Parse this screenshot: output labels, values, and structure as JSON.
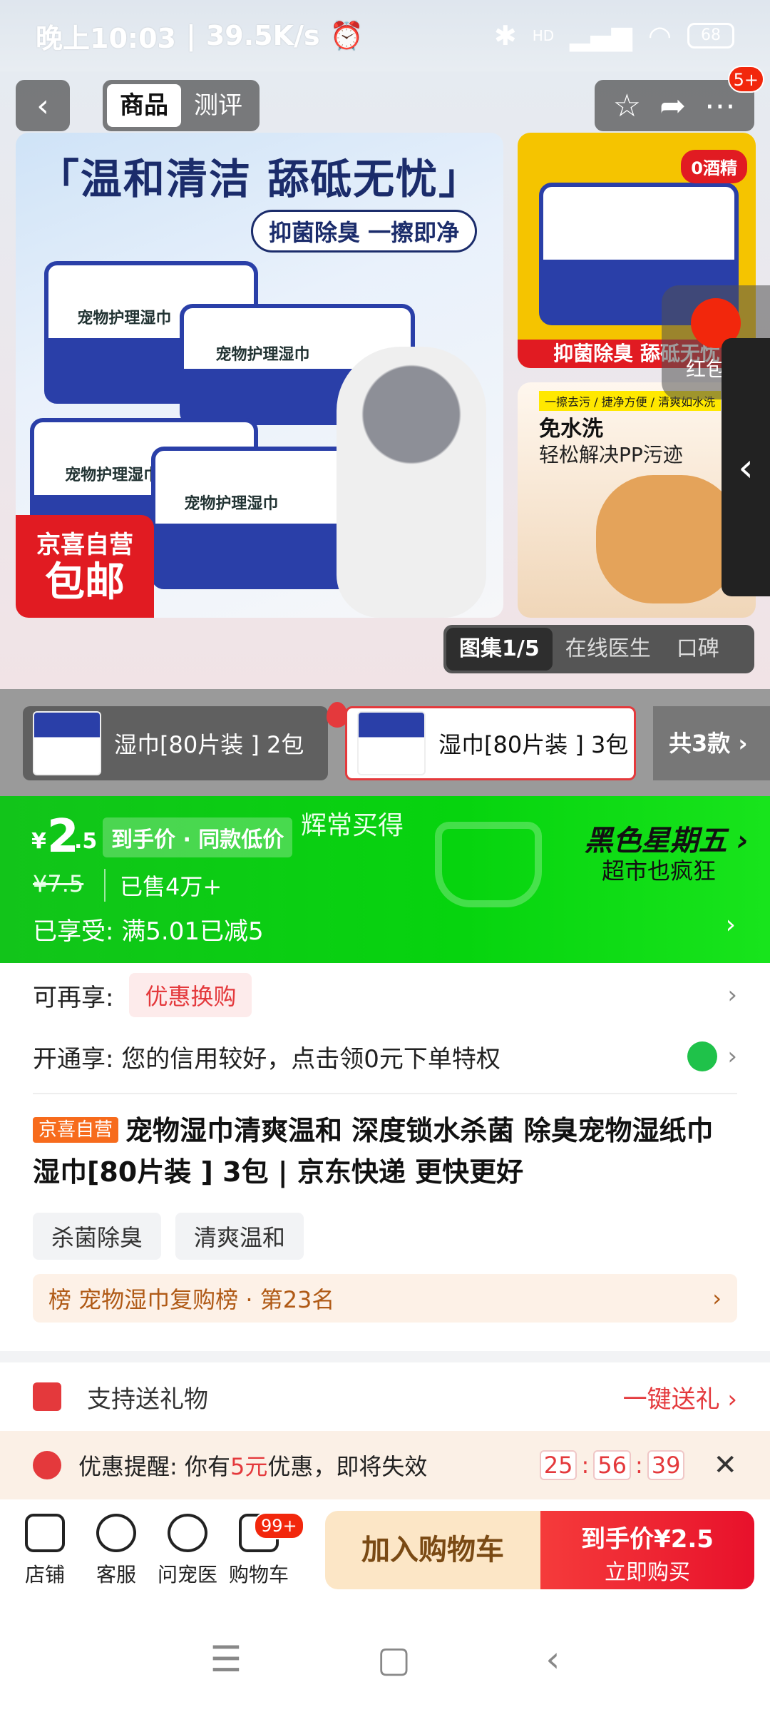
{
  "status": {
    "time": "晚上10:03",
    "speed": "39.5K/s",
    "battery": "68",
    "network": "HD"
  },
  "topnav": {
    "tabs": [
      "商品",
      "测评"
    ],
    "badge": "5+"
  },
  "main_image": {
    "headline": "「温和清洁 舔砥无忧」",
    "subline": "抑菌除臭 一擦即净",
    "pack_label": "宠物护理湿巾",
    "promo_line1": "京喜自营",
    "promo_line2": "包邮"
  },
  "thumb1": {
    "badge": "0酒精",
    "caption": "抑菌除臭 舔砥无忧"
  },
  "thumb2": {
    "tag": "一擦去污 / 捷净方便 / 清爽如水洗",
    "line1": "免水洗",
    "line2": "轻松解决PP污迹"
  },
  "redpack": {
    "label": "红包雨"
  },
  "gallery_tabs": [
    "图集1/5",
    "在线医生",
    "口碑"
  ],
  "sku": {
    "item1": "湿巾[80片装 ] 2包",
    "item2": "湿巾[80片装 ] 3包",
    "count": "共3款 ›"
  },
  "price": {
    "currency": "¥",
    "int": "2",
    "dec": ".5",
    "tag": "到手价 · 同款低价",
    "hui": "辉常买得",
    "original": "¥7.5",
    "sold": "已售4万+",
    "enjoy": "已享受:  满5.01已减5",
    "bf_title": "黑色星期五 ›",
    "bf_sub": "超市也疯狂"
  },
  "info": {
    "coupon_label": "可再享:",
    "coupon_pill": "优惠换购",
    "credit": "开通享:  您的信用较好，点击领0元下单特权",
    "jx_tag": "京喜自营",
    "title": "宠物湿巾清爽温和 深度锁水杀菌 除臭宠物湿纸巾 湿巾[80片装 ] 3包 | 京东快递 更快更好",
    "chips": [
      "杀菌除臭",
      "清爽温和"
    ],
    "rank": "榜 宠物湿巾复购榜 · 第23名"
  },
  "gift": {
    "label": "支持送礼物",
    "action": "一键送礼 ›"
  },
  "reminder": {
    "prefix": "优惠提醒:  你有",
    "amount": "5元",
    "suffix": "优惠，即将失效",
    "h": "25",
    "m": "56",
    "s": "39"
  },
  "bottom": {
    "nav": [
      "店铺",
      "客服",
      "问宠医",
      "购物车"
    ],
    "cart_badge": "99+",
    "addcart": "加入购物车",
    "buy_line1": "到手价¥2.5",
    "buy_line2": "立即购买"
  },
  "colors": {
    "accent_red": "#e4393c",
    "price_green": "#12c41a"
  }
}
